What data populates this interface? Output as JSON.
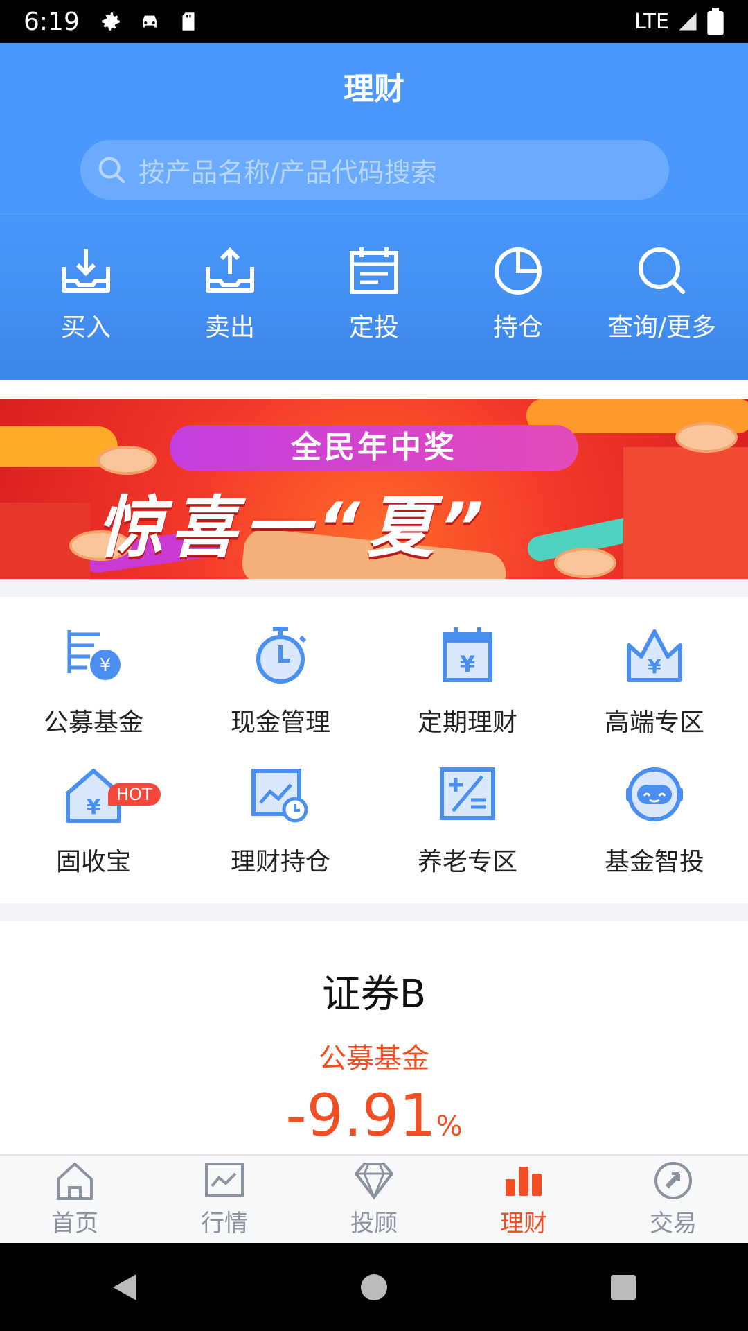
{
  "status_bar": {
    "time": "6:19",
    "network": "LTE"
  },
  "header": {
    "title": "理财"
  },
  "search": {
    "placeholder": "按产品名称/产品代码搜索"
  },
  "quick_actions": [
    {
      "label": "买入",
      "icon": "download-tray-icon"
    },
    {
      "label": "卖出",
      "icon": "upload-tray-icon"
    },
    {
      "label": "定投",
      "icon": "calendar-icon"
    },
    {
      "label": "持仓",
      "icon": "pie-chart-icon"
    },
    {
      "label": "查询/更多",
      "icon": "search-icon"
    }
  ],
  "banner": {
    "headline": "全民年中奖",
    "tagline": "惊喜一“夏”"
  },
  "categories": [
    {
      "label": "公募基金",
      "icon": "fund-icon"
    },
    {
      "label": "现金管理",
      "icon": "stopwatch-icon"
    },
    {
      "label": "定期理财",
      "icon": "calendar-yen-icon"
    },
    {
      "label": "高端专区",
      "icon": "crown-icon"
    },
    {
      "label": "固收宝",
      "icon": "house-yen-icon",
      "badge": "HOT"
    },
    {
      "label": "理财持仓",
      "icon": "chart-clock-icon"
    },
    {
      "label": "养老专区",
      "icon": "calculator-icon"
    },
    {
      "label": "基金智投",
      "icon": "robot-icon"
    }
  ],
  "featured": {
    "name": "证券B",
    "category": "公募基金",
    "rate": "-9.91",
    "rate_unit": "%"
  },
  "tabs": [
    {
      "label": "首页",
      "icon": "home-icon",
      "active": false
    },
    {
      "label": "行情",
      "icon": "market-chart-icon",
      "active": false
    },
    {
      "label": "投顾",
      "icon": "diamond-icon",
      "active": false
    },
    {
      "label": "理财",
      "icon": "bar-chart-icon",
      "active": true
    },
    {
      "label": "交易",
      "icon": "exchange-icon",
      "active": false
    }
  ],
  "colors": {
    "primary_blue": "#4a98fb",
    "accent_red": "#f04e23",
    "icon_blue": "#4a8ef0"
  }
}
